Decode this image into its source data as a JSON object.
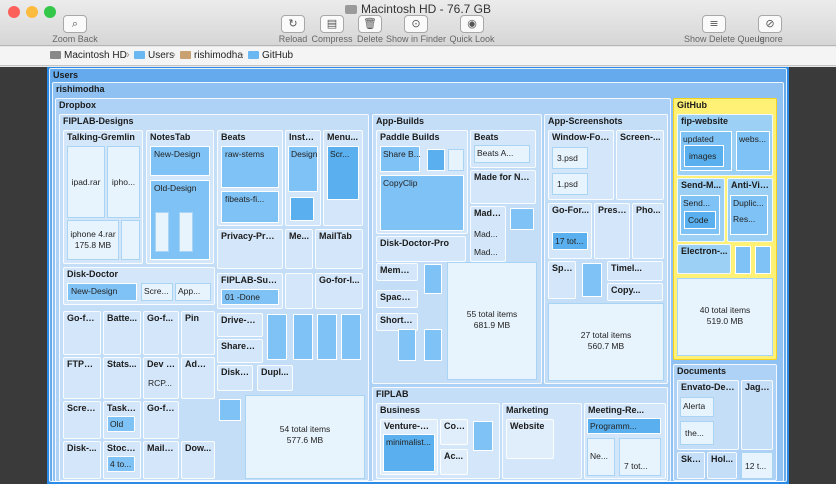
{
  "window": {
    "title": "Macintosh HD - 76.7 GB"
  },
  "toolbar": {
    "zoom_back": "Zoom Back",
    "reload": "Reload",
    "compress": "Compress",
    "delete": "Delete",
    "show_in_finder": "Show in Finder",
    "quick_look": "Quick Look",
    "show_delete_queue": "Show Delete Queue",
    "ignore": "Ignore"
  },
  "breadcrumb": [
    "Macintosh HD",
    "Users",
    "rishimodha",
    "GitHub"
  ],
  "treemap": {
    "users": "Users",
    "rishimodha": "rishimodha",
    "dropbox": "Dropbox",
    "fiplab_designs": "FIPLAB-Designs",
    "talking_gremlin": "Talking-Gremlin",
    "ipad_rar": "ipad.rar",
    "ipho": "ipho...",
    "iphone4_rar": "iphone 4.rar",
    "iphone4_size": "175.8 MB",
    "notestab": "NotesTab",
    "new_design": "New-Design",
    "old_design": "Old-Design",
    "beats": "Beats",
    "raw_stems": "raw-stems",
    "fibeats": "fibeats-fi...",
    "instar": "InstaR...",
    "design": "Design",
    "menu": "Menu...",
    "scr": "Scr...",
    "privacy": "Privacy-Prot...",
    "me": "Me...",
    "mailtab": "MailTab",
    "disk_doctor": "Disk-Doctor",
    "dd_new_design": "New-Design",
    "scre": "Scre...",
    "app": "App...",
    "fiplab_subp": "FIPLAB-SubP...",
    "done": "01 -Done",
    "go_for_l": "Go-for-l...",
    "go_fo": "Go-fo...",
    "batte": "Batte...",
    "go_f": "Go-f...",
    "pin": "Pin",
    "drive_cl": "Drive-Cl...",
    "sharebu": "ShareBu...",
    "ftpbot": "FTPBot",
    "stats": "Stats...",
    "devt": "Dev T...",
    "adbl": "AdBl...",
    "rcp": "RCP...",
    "disk_": "Disk-...",
    "dupl": "Dupl...",
    "scree": "Scree...",
    "tasktab": "TaskT...",
    "old": "Old",
    "go_fo2": "Go-fo...",
    "disk_2": "Disk-...",
    "stock": "Stock...",
    "four_to": "4 to...",
    "mailt": "MailT...",
    "dow": "Dow...",
    "total54": "54 total items",
    "size54": "577.6 MB",
    "app_builds": "App-Builds",
    "paddle_builds": "Paddle Builds",
    "share_b": "Share B...",
    "copyclip": "CopyClip",
    "ab_beats": "Beats",
    "beats_a": "Beats A...",
    "made_for_net": "Made for Net...",
    "made": "Made...",
    "mad1": "Mad...",
    "mad2": "Mad...",
    "disk_doctor_pro": "Disk-Doctor-Pro",
    "memor": "Memor...",
    "spaced": "SpaceD...",
    "shortcu": "Shortcu...",
    "total55": "55 total items",
    "size55": "681.9 MB",
    "app_screenshots": "App-Screenshots",
    "window_focus": "Window-Focus",
    "screen": "Screen-...",
    "three_psd": "3.psd",
    "one_psd": "1.psd",
    "go_for": "Go-For...",
    "prese": "Prese...",
    "pho": "Pho...",
    "seventeen_tot": "17 tot...",
    "spa": "Spa...",
    "timel": "Timel...",
    "copy": "Copy...",
    "total27": "27 total items",
    "size27": "560.7 MB",
    "fiplab": "FIPLAB",
    "business": "Business",
    "venture": "Venture-Ca...",
    "minimalist": "minimalist...",
    "cont": "Cont...",
    "ac": "Ac...",
    "marketing": "Marketing",
    "website": "Website",
    "meeting": "Meeting-Re...",
    "programm": "Programm...",
    "ne": "Ne...",
    "seven_tot": "7 tot...",
    "github": "GitHub",
    "fip_website": "fip-website",
    "updated": "updated",
    "images": "images",
    "webs": "webs...",
    "send_m": "Send-M...",
    "anti_vir": "Anti-Vir...",
    "send": "Send...",
    "duplic": "Duplic...",
    "code": "Code",
    "res": "Res...",
    "electron": "Electron-...",
    "total40": "40 total items",
    "size40": "519.0 MB",
    "documents": "Documents",
    "envato": "Envato-Desi...",
    "jagr": "Jagr...",
    "alerta": "Alerta",
    "the": "the...",
    "sket": "Sket...",
    "hol": "Hol...",
    "twelve_t": "12 t..."
  },
  "colors": {
    "canvas": "#2a8ae6",
    "highlight": "#fff176",
    "block": "#7fc2f5"
  }
}
